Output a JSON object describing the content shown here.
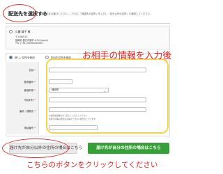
{
  "header": {
    "title": "配送先を選択する",
    "description": "お届け先をお選びください。こちらに「発送先の住所」を入力し「自分以外の住所」を選択してください。"
  },
  "saved_address": {
    "name": "久藤 慎子 様",
    "line1": "〒1160013",
    "line2": "福岡県 春日市原町 4-24 (Japan)",
    "line3": "TEL [+81] 00000000000"
  },
  "new_address": {
    "option_new": "新しい住所を使用",
    "option_same": "別のお住所を使用"
  },
  "form": {
    "labels": {
      "name": "名前",
      "postal": "郵便番号",
      "prefecture": "都道府県",
      "city": "市区町村",
      "address": "番地・建物名",
      "phone": "電話番号"
    },
    "required_mark": "*",
    "prefecture_value": "福岡県",
    "prefecture_chevron": "⌄",
    "address_note_1": "※住所は建物名まで正しく入力してください",
    "address_note_2": "住所不詳等の場合はお届けできない場合がございます"
  },
  "annotations": {
    "fill_after": "お相手の情報を入力後",
    "click_button": "こちらのボタンをクリックしてください"
  },
  "buttons": {
    "other": "届け先が自分以外の住所の場合はこちら",
    "self": "届け先が自分の住所の場合はこちら"
  },
  "colors": {
    "annotation_red": "#e8231f",
    "highlight_yellow": "#f3d54a",
    "button_green": "#35a037"
  }
}
